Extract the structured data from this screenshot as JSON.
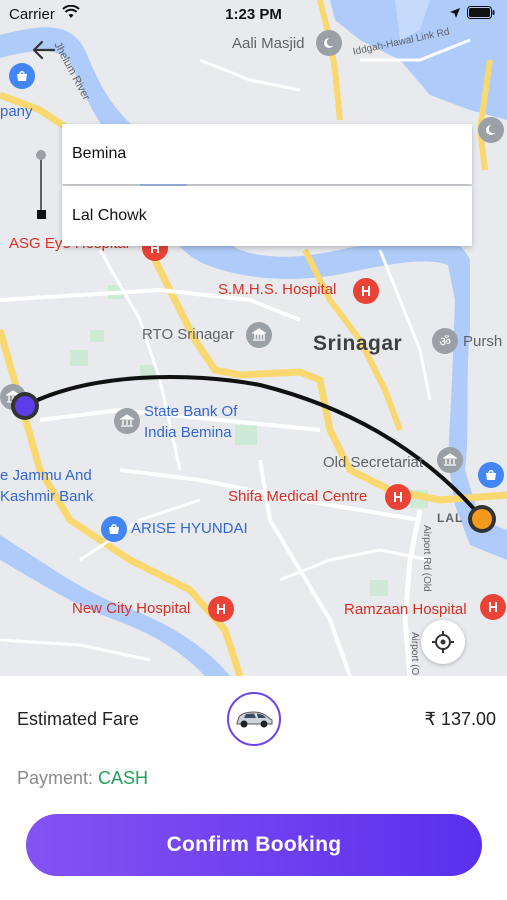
{
  "status_bar": {
    "carrier": "Carrier",
    "time": "1:23 PM"
  },
  "route": {
    "pickup": "Bemina",
    "destination": "Lal Chowk"
  },
  "map": {
    "labels": {
      "aali_masjid": "Aali Masjid",
      "jhelum_river": "Jhelum River",
      "iddgah_road": "Iddgah-Hawal Link Rd",
      "company_partial": "pany",
      "asg_hospital": "ASG Eye Hospital",
      "smhs_hospital": "S.M.H.S. Hospital",
      "rto": "RTO Srinagar",
      "srinagar": "Srinagar",
      "purshyar": "Pursh",
      "sbi_line1": "State Bank Of",
      "sbi_line2": "India Bemina",
      "jk_bank_line1": "e Jammu And",
      "jk_bank_line2": "Kashmir Bank",
      "old_secretariat": "Old Secretariat",
      "shifa": "Shifa Medical Centre",
      "arise_hyundai": "ARISE HYUNDAI",
      "lal_chowk_map": "LAL",
      "new_city_hospital": "New City Hospital",
      "ramzaan_hospital": "Ramzaan Hospital",
      "airport_road_1": "Airport Rd (Old",
      "airport_road_2": "Airport (O"
    }
  },
  "fare": {
    "label": "Estimated Fare",
    "amount": "₹ 137.00"
  },
  "payment": {
    "label": "Payment:",
    "method": "CASH"
  },
  "actions": {
    "confirm_label": "Confirm Booking"
  },
  "colors": {
    "accent": "#6b45e6",
    "pickup_marker": "#5b3ee8",
    "drop_marker": "#f39a1e",
    "payment_method": "#23a15b",
    "hospital_red": "#d93025"
  }
}
